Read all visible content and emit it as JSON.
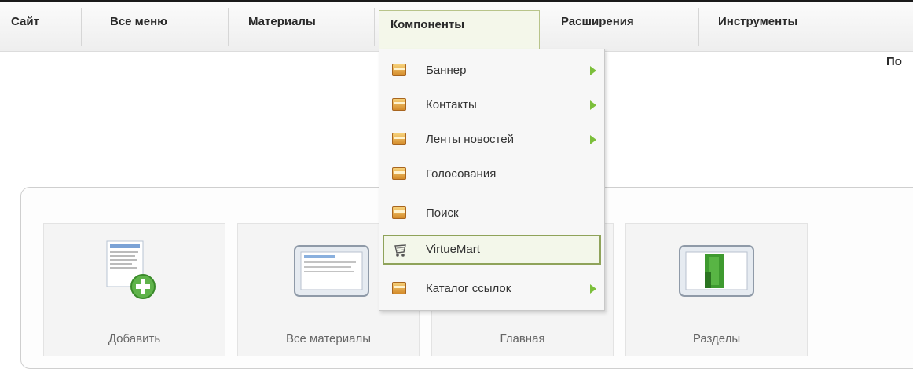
{
  "menu": {
    "items": [
      "Сайт",
      "Все меню",
      "Материалы",
      "Компоненты",
      "Расширения",
      "Инструменты"
    ],
    "right_partial": "По"
  },
  "dropdown": {
    "items": [
      {
        "label": "Баннер",
        "submenu": true
      },
      {
        "label": "Контакты",
        "submenu": true
      },
      {
        "label": "Ленты новостей",
        "submenu": true
      },
      {
        "label": "Голосования",
        "submenu": false
      },
      {
        "label": "Поиск",
        "submenu": false
      },
      {
        "label": "VirtueMart",
        "submenu": false,
        "highlighted": true
      },
      {
        "label": "Каталог ссылок",
        "submenu": true
      }
    ]
  },
  "panel": {
    "tiles": [
      "Добавить",
      "Все материалы",
      "Главная",
      "Разделы"
    ]
  },
  "colors": {
    "submenu_arrow": "#7cbf3b",
    "highlight_border": "#8fa35a",
    "active_menu_bg": "#f4f7ea"
  }
}
